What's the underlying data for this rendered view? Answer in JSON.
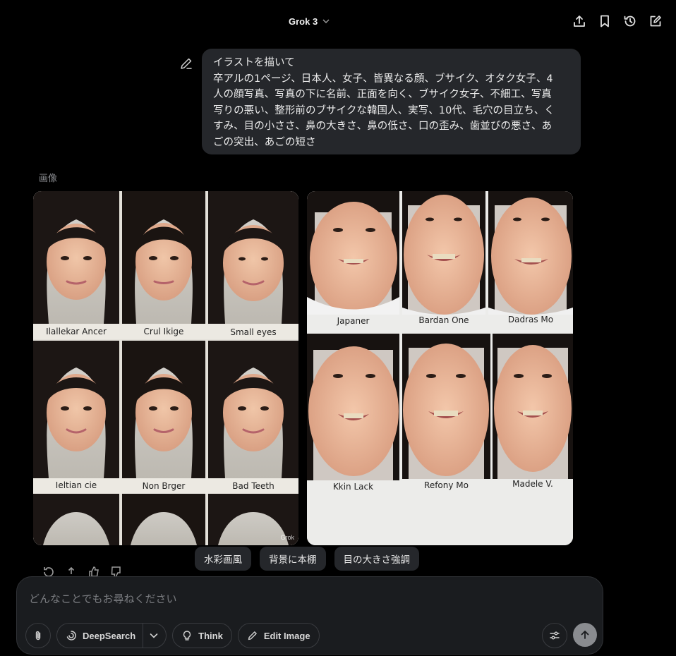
{
  "header": {
    "model_label": "Grok 3",
    "actions": [
      "share-icon",
      "bookmark-icon",
      "history-icon",
      "new-chat-icon"
    ]
  },
  "user_message": {
    "lines": [
      "イラストを描いて",
      "卒アルの1ページ、日本人、女子、皆異なる顔、ブサイク、オタク女子、4",
      "人の顔写真、写真の下に名前、正面を向く、ブサイク女子、不細工、写真",
      "写りの悪い、整形前のブサイクな韓国人、実写、10代、毛穴の目立ち、く",
      "すみ、目の小ささ、鼻の大きさ、鼻の低さ、口の歪み、歯並びの悪さ、あ",
      "ごの突出、あごの短さ"
    ]
  },
  "response": {
    "images_label": "画像",
    "image_a": {
      "captions": [
        "Ilalleka​r Ancer",
        "Crul Ikige",
        "Small eyes",
        "Ieltian cie",
        "Non Brger",
        "Bad Teeth"
      ],
      "watermark": "Grok"
    },
    "image_b": {
      "captions": [
        "Japaner",
        "Bardan One",
        "Dadras Mo",
        "Kkin Lack",
        "Refony Mo",
        "Madele V."
      ]
    },
    "suggestions": [
      "水彩画風",
      "背景に本棚",
      "目の大きさ強調"
    ]
  },
  "composer": {
    "placeholder": "どんなことでもお尋ねください",
    "deepsearch_label": "DeepSearch",
    "think_label": "Think",
    "edit_image_label": "Edit Image"
  },
  "colors": {
    "background": "#000000",
    "bubble": "#25272b",
    "composer": "#1a1c1f",
    "send_button": "#8a8c90"
  }
}
